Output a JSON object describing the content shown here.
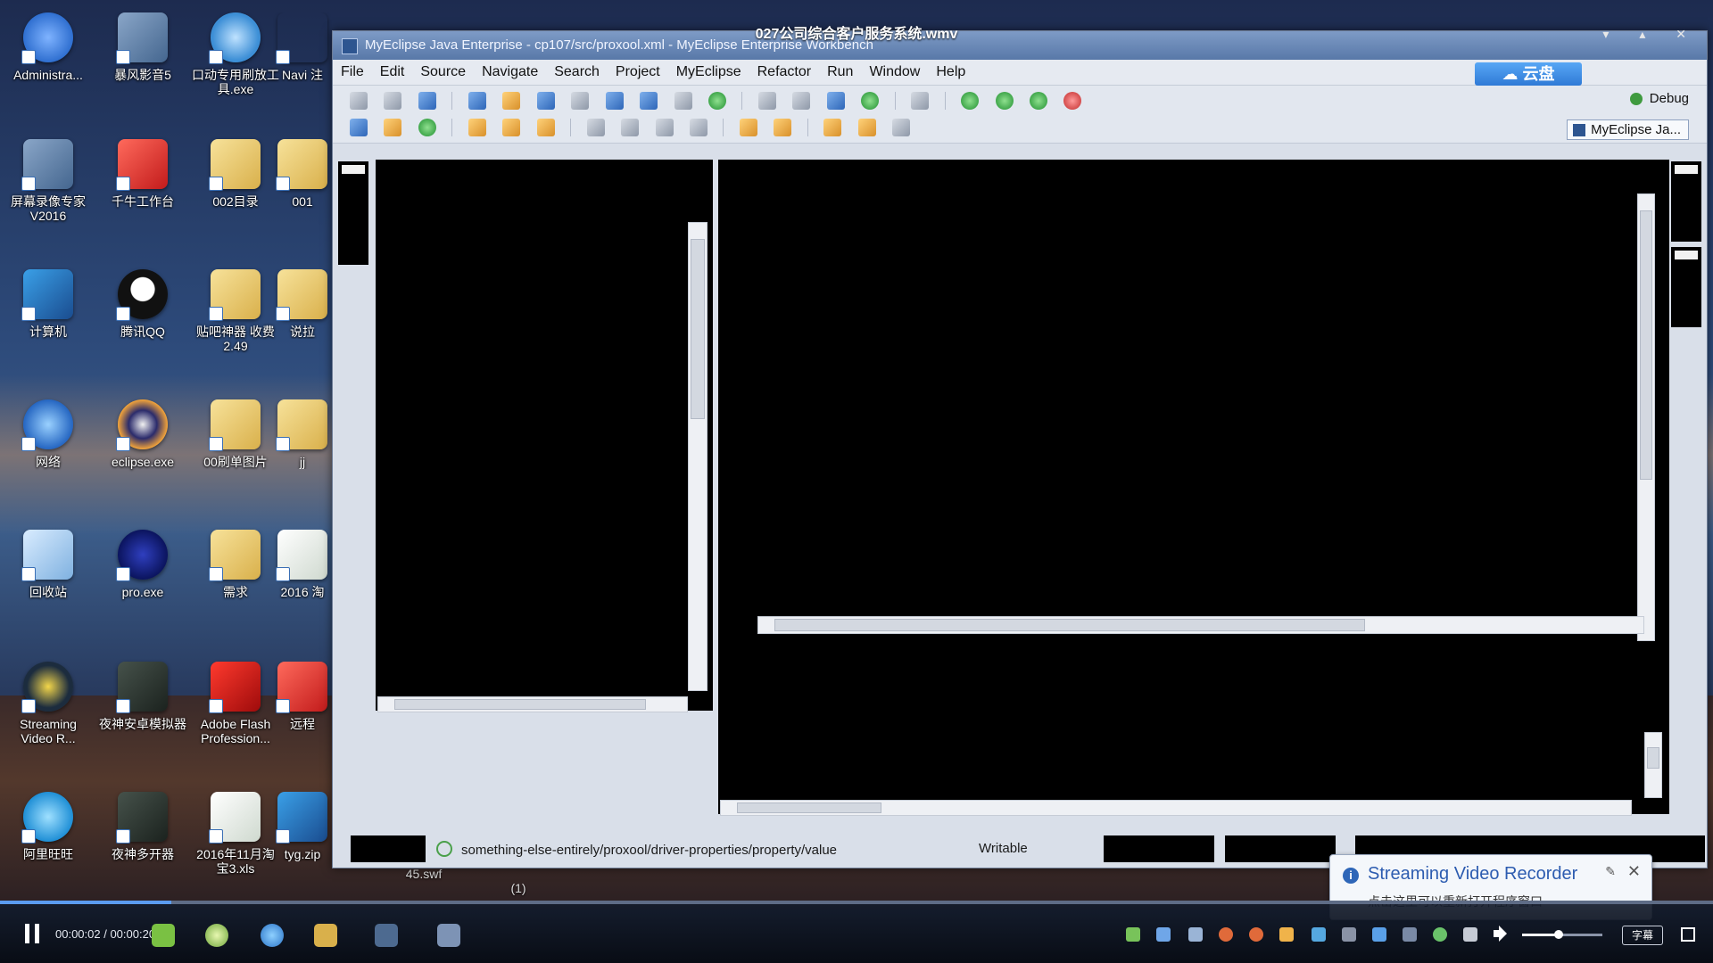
{
  "video": {
    "title": "027公司综合客户服务系统.wmv",
    "time": "00:00:02 / 00:00:20",
    "progress": 0.1,
    "volume": 0.45,
    "subtitle_btn": "字幕"
  },
  "desktop": {
    "icons": [
      {
        "label": "Administra...",
        "icon": "star-icon"
      },
      {
        "label": "暴风影音5",
        "icon": "storm-player-icon"
      },
      {
        "label": "口动专用刷放工具.exe",
        "icon": "magnifier-icon"
      },
      {
        "label": "Navi 注",
        "icon": "app-icon"
      },
      {
        "label": "屏幕录像专家V2016",
        "icon": "screen-recorder-icon"
      },
      {
        "label": "千牛工作台",
        "icon": "qianniu-icon"
      },
      {
        "label": "002目录",
        "icon": "folder-icon"
      },
      {
        "label": "001",
        "icon": "folder-icon"
      },
      {
        "label": "计算机",
        "icon": "computer-icon"
      },
      {
        "label": "腾讯QQ",
        "icon": "qq-icon"
      },
      {
        "label": "贴吧神器 收费2.49",
        "icon": "folder-icon"
      },
      {
        "label": "说拉",
        "icon": "folder-icon"
      },
      {
        "label": "网络",
        "icon": "network-globe-icon"
      },
      {
        "label": "eclipse.exe",
        "icon": "eclipse-icon"
      },
      {
        "label": "00刷单图片",
        "icon": "folder-icon"
      },
      {
        "label": "jj",
        "icon": "folder-icon"
      },
      {
        "label": "回收站",
        "icon": "recycle-bin-icon"
      },
      {
        "label": "pro.exe",
        "icon": "pro-exe-icon"
      },
      {
        "label": "需求",
        "icon": "folder-icon"
      },
      {
        "label": "2016 淘",
        "icon": "excel-icon"
      },
      {
        "label": "Streaming Video R...",
        "icon": "streaming-recorder-icon"
      },
      {
        "label": "夜神安卓模拟器",
        "icon": "nox-icon"
      },
      {
        "label": "Adobe Flash Profession...",
        "icon": "flash-icon"
      },
      {
        "label": "远程",
        "icon": "remote-icon"
      },
      {
        "label": "阿里旺旺",
        "icon": "wangwang-icon"
      },
      {
        "label": "夜神多开器",
        "icon": "nox-multi-icon"
      },
      {
        "label": "2016年11月淘宝3.xls",
        "icon": "excel-icon"
      },
      {
        "label": "tyg.zip",
        "icon": "zip-icon"
      }
    ],
    "behind_labels": [
      "45.swf",
      "(1)"
    ]
  },
  "window": {
    "title": "MyEclipse Java Enterprise - cp107/src/proxool.xml - MyEclipse Enterprise Workbench",
    "menus": [
      "File",
      "Edit",
      "Source",
      "Navigate",
      "Search",
      "Project",
      "MyEclipse",
      "Refactor",
      "Run",
      "Window",
      "Help"
    ],
    "cloud_label": "云盘",
    "perspective_debug": "Debug",
    "perspective_active": "MyEclipse Ja...",
    "status_path": "something-else-entirely/proxool/driver-properties/property/value",
    "status_mode": "Writable"
  },
  "notification": {
    "title": "Streaming Video Recorder",
    "text": "点击这里可以重新打开程序窗口"
  }
}
